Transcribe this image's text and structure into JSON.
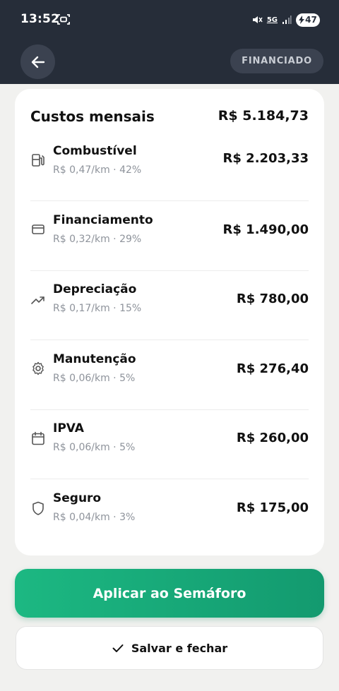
{
  "status_bar": {
    "time": "13:52",
    "network": "5G",
    "battery": "47"
  },
  "header": {
    "mode_badge": "FINANCIADO"
  },
  "card": {
    "title": "Custos mensais",
    "total": "R$ 5.184,73",
    "items": [
      {
        "label": "Combustível",
        "meta": "R$ 0,47/km · 42%",
        "amount": "R$ 2.203,33",
        "icon": "fuel-pump-icon"
      },
      {
        "label": "Financiamento",
        "meta": "R$ 0,32/km · 29%",
        "amount": "R$ 1.490,00",
        "icon": "credit-card-icon"
      },
      {
        "label": "Depreciação",
        "meta": "R$ 0,17/km · 15%",
        "amount": "R$ 780,00",
        "icon": "trending-icon"
      },
      {
        "label": "Manutenção",
        "meta": "R$ 0,06/km · 5%",
        "amount": "R$ 276,40",
        "icon": "gear-icon"
      },
      {
        "label": "IPVA",
        "meta": "R$ 0,06/km · 5%",
        "amount": "R$ 260,00",
        "icon": "calendar-icon"
      },
      {
        "label": "Seguro",
        "meta": "R$ 0,04/km · 3%",
        "amount": "R$ 175,00",
        "icon": "shield-icon"
      }
    ]
  },
  "actions": {
    "apply_label": "Aplicar ao Semáforo",
    "save_label": "Salvar e fechar"
  },
  "colors": {
    "header_bg": "#262d39",
    "accent_green": "#1cb882",
    "page_bg": "#f1f1ef"
  }
}
